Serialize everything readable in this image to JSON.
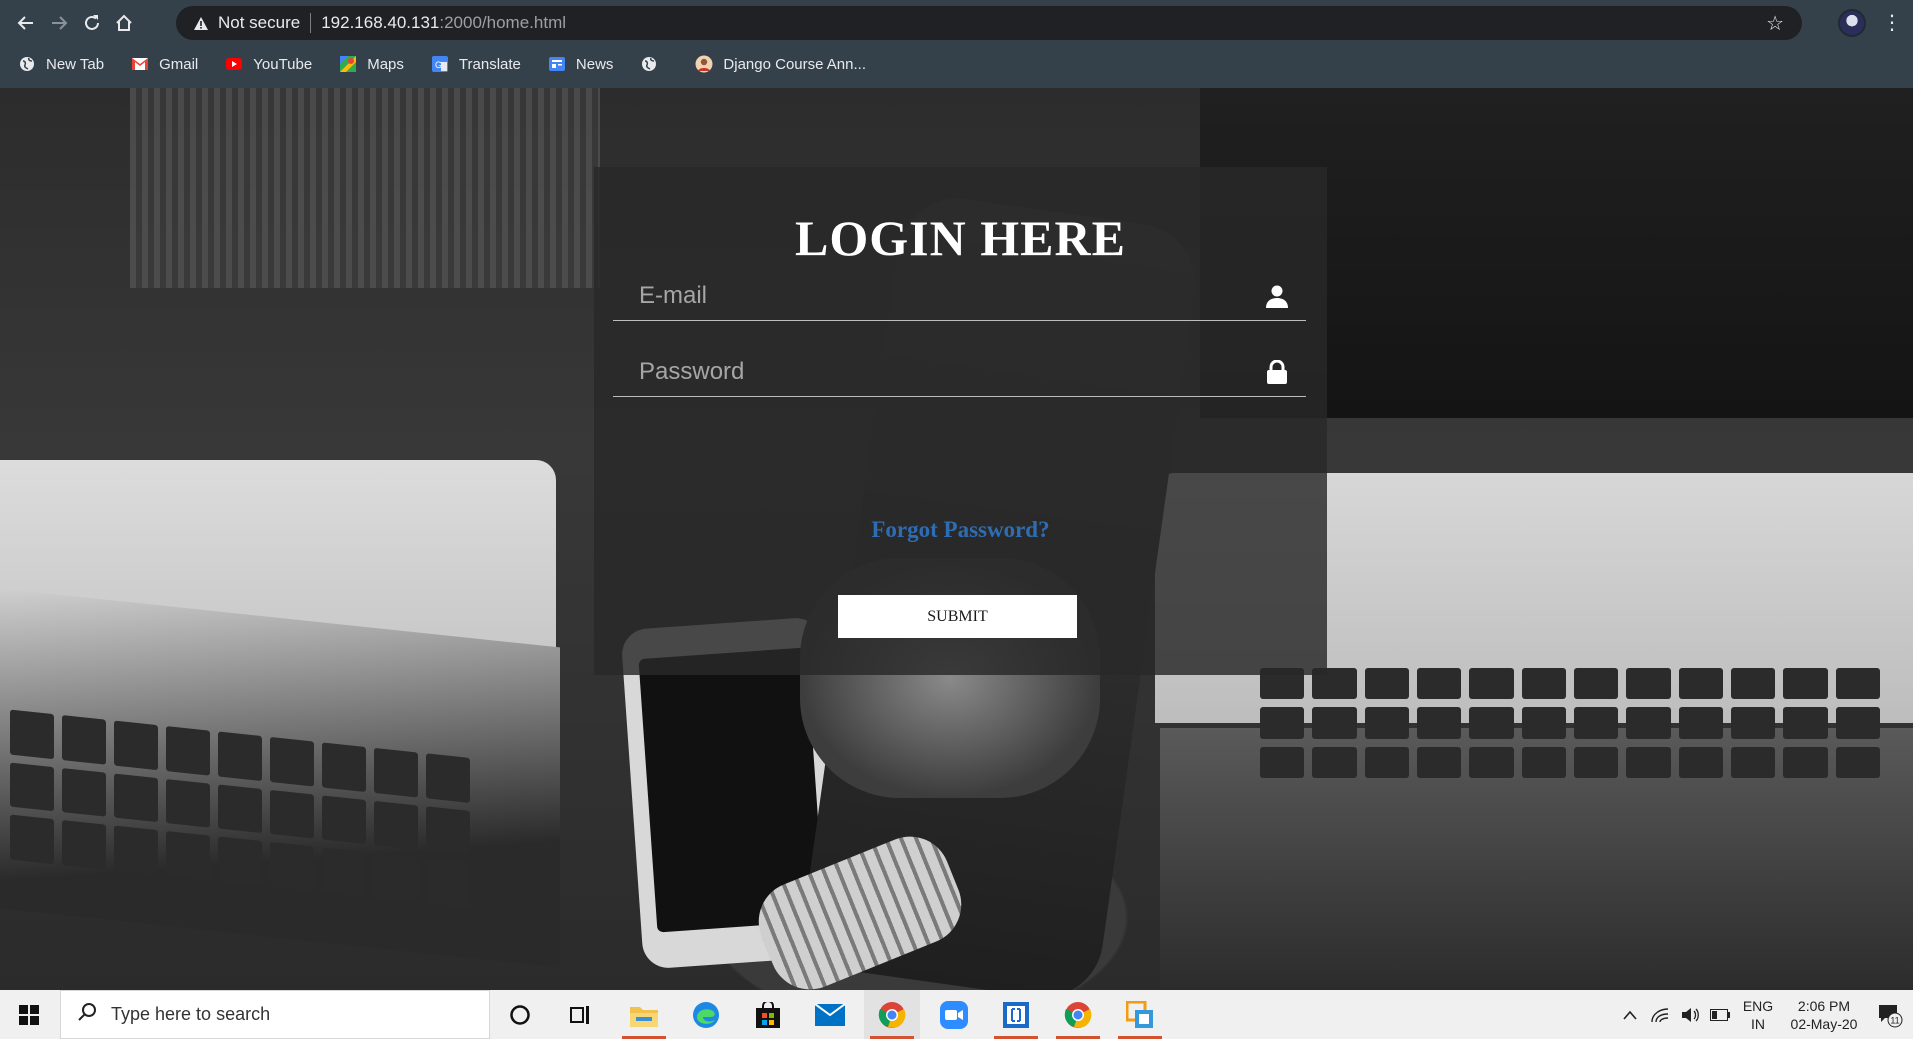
{
  "browser": {
    "security_label": "Not secure",
    "url_host": "192.168.40.131",
    "url_path": ":2000/home.html",
    "bookmarks": [
      {
        "label": "New Tab",
        "icon": "globe-icon"
      },
      {
        "label": "Gmail",
        "icon": "gmail-icon"
      },
      {
        "label": "YouTube",
        "icon": "youtube-icon"
      },
      {
        "label": "Maps",
        "icon": "maps-icon"
      },
      {
        "label": "Translate",
        "icon": "translate-icon"
      },
      {
        "label": "News",
        "icon": "news-icon"
      },
      {
        "label": "",
        "icon": "globe-icon"
      },
      {
        "label": "Django Course Ann...",
        "icon": "django-course-icon"
      }
    ]
  },
  "login": {
    "title": "LOGIN HERE",
    "email_placeholder": "E-mail",
    "password_placeholder": "Password",
    "forgot_label": "Forgot Password?",
    "submit_label": "SUBMIT"
  },
  "colors": {
    "chrome_bg": "#35414a",
    "omnibox_bg": "#202124",
    "card_bg": "rgba(40,40,40,0.82)",
    "link": "#2e6db3",
    "taskbar_bg": "#f0f0f0"
  },
  "taskbar": {
    "search_placeholder": "Type here to search",
    "apps": [
      "cortana-icon",
      "task-view-icon",
      "file-explorer-icon",
      "edge-icon",
      "store-icon",
      "mail-icon",
      "chrome-icon",
      "zoom-icon",
      "code-icon",
      "chrome-icon",
      "remote-desktop-icon"
    ],
    "lang_top": "ENG",
    "lang_bottom": "IN",
    "time": "2:06 PM",
    "date": "02-May-20",
    "notification_count": "11"
  }
}
